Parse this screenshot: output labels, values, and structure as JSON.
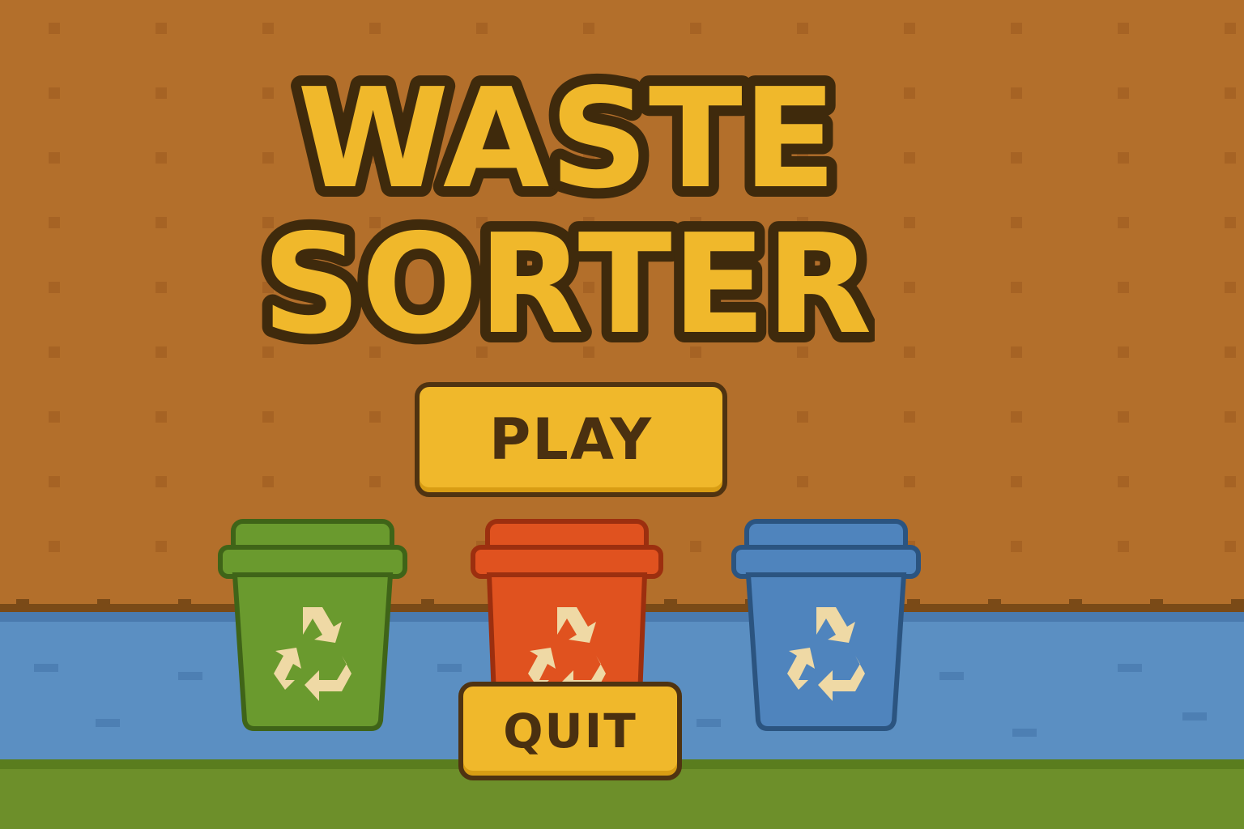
{
  "title": {
    "line1": "WASTE",
    "line2": "SORTER"
  },
  "menu": {
    "play_label": "PLAY",
    "quit_label": "QUIT"
  },
  "bins": [
    {
      "name": "green-bin",
      "icon": "recycle-icon",
      "color": "#6a9a2e",
      "dark": "#3f6418"
    },
    {
      "name": "red-bin",
      "icon": "recycle-icon",
      "color": "#e0521f",
      "dark": "#9c2f0f"
    },
    {
      "name": "blue-bin",
      "icon": "recycle-icon",
      "color": "#4f84bd",
      "dark": "#2b5480"
    }
  ],
  "colors": {
    "wall": "#b36f2b",
    "river": "#5b8fc2",
    "grass": "#6d8f2a",
    "title_fill": "#f0b82b",
    "title_outline": "#4f3311",
    "button": "#f0b82b",
    "recycle_symbol": "#efd9a5"
  }
}
